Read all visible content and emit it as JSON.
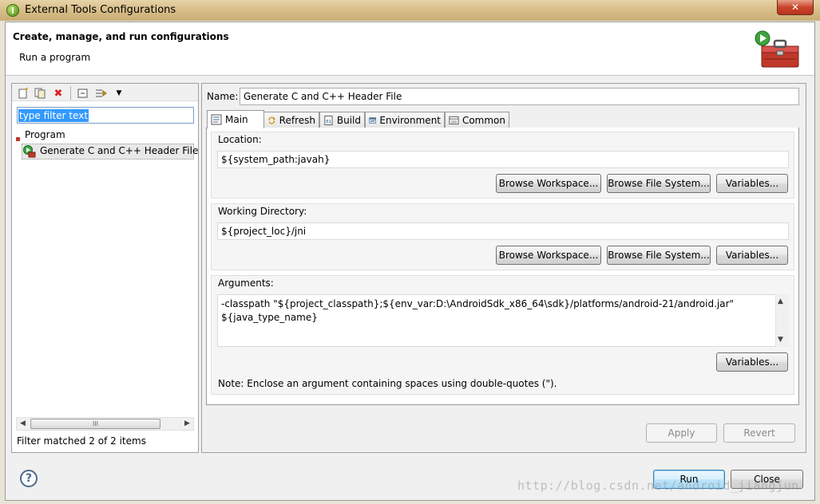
{
  "window": {
    "title": "External Tools Configurations",
    "close_glyph": "✕"
  },
  "header": {
    "title": "Create, manage, and run configurations",
    "subtitle": "Run a program",
    "icon": "toolbox-run-icon"
  },
  "left": {
    "toolbar_icons": [
      "new-config-icon",
      "duplicate-icon",
      "delete-icon",
      "collapse-all-icon",
      "filter-icon",
      "dropdown-arrow-icon"
    ],
    "filter_placeholder": "type filter text",
    "filter_value": "type filter text",
    "tree": {
      "category": "Program",
      "items": [
        "Generate C and C++ Header File"
      ]
    },
    "scroll_grip": "III",
    "status": "Filter matched 2 of 2 items"
  },
  "right": {
    "name_label": "Name:",
    "name_value": "Generate C and C++ Header File",
    "tabs": [
      {
        "label": "Main",
        "icon": "main-tab-icon",
        "active": true
      },
      {
        "label": "Refresh",
        "icon": "refresh-icon",
        "active": false
      },
      {
        "label": "Build",
        "icon": "build-icon",
        "active": false
      },
      {
        "label": "Environment",
        "icon": "environment-icon",
        "active": false
      },
      {
        "label": "Common",
        "icon": "common-icon",
        "active": false
      }
    ],
    "location": {
      "label": "Location:",
      "value": "${system_path:javah}"
    },
    "working_dir": {
      "label": "Working Directory:",
      "value": "${project_loc}/jni"
    },
    "arguments": {
      "label": "Arguments:",
      "value": "-classpath \"${project_classpath};${env_var:D:\\AndroidSdk_x86_64\\sdk}/platforms/android-21/android.jar\"\n${java_type_name}",
      "note": "Note: Enclose an argument containing spaces using double-quotes (\")."
    },
    "buttons": {
      "browse_workspace": "Browse Workspace...",
      "browse_fs": "Browse File System...",
      "variables": "Variables...",
      "apply": "Apply",
      "revert": "Revert"
    }
  },
  "footer": {
    "help_glyph": "?",
    "run": "Run",
    "close": "Close"
  },
  "watermark": "http://blog.csdn.net/android_jiangjun"
}
